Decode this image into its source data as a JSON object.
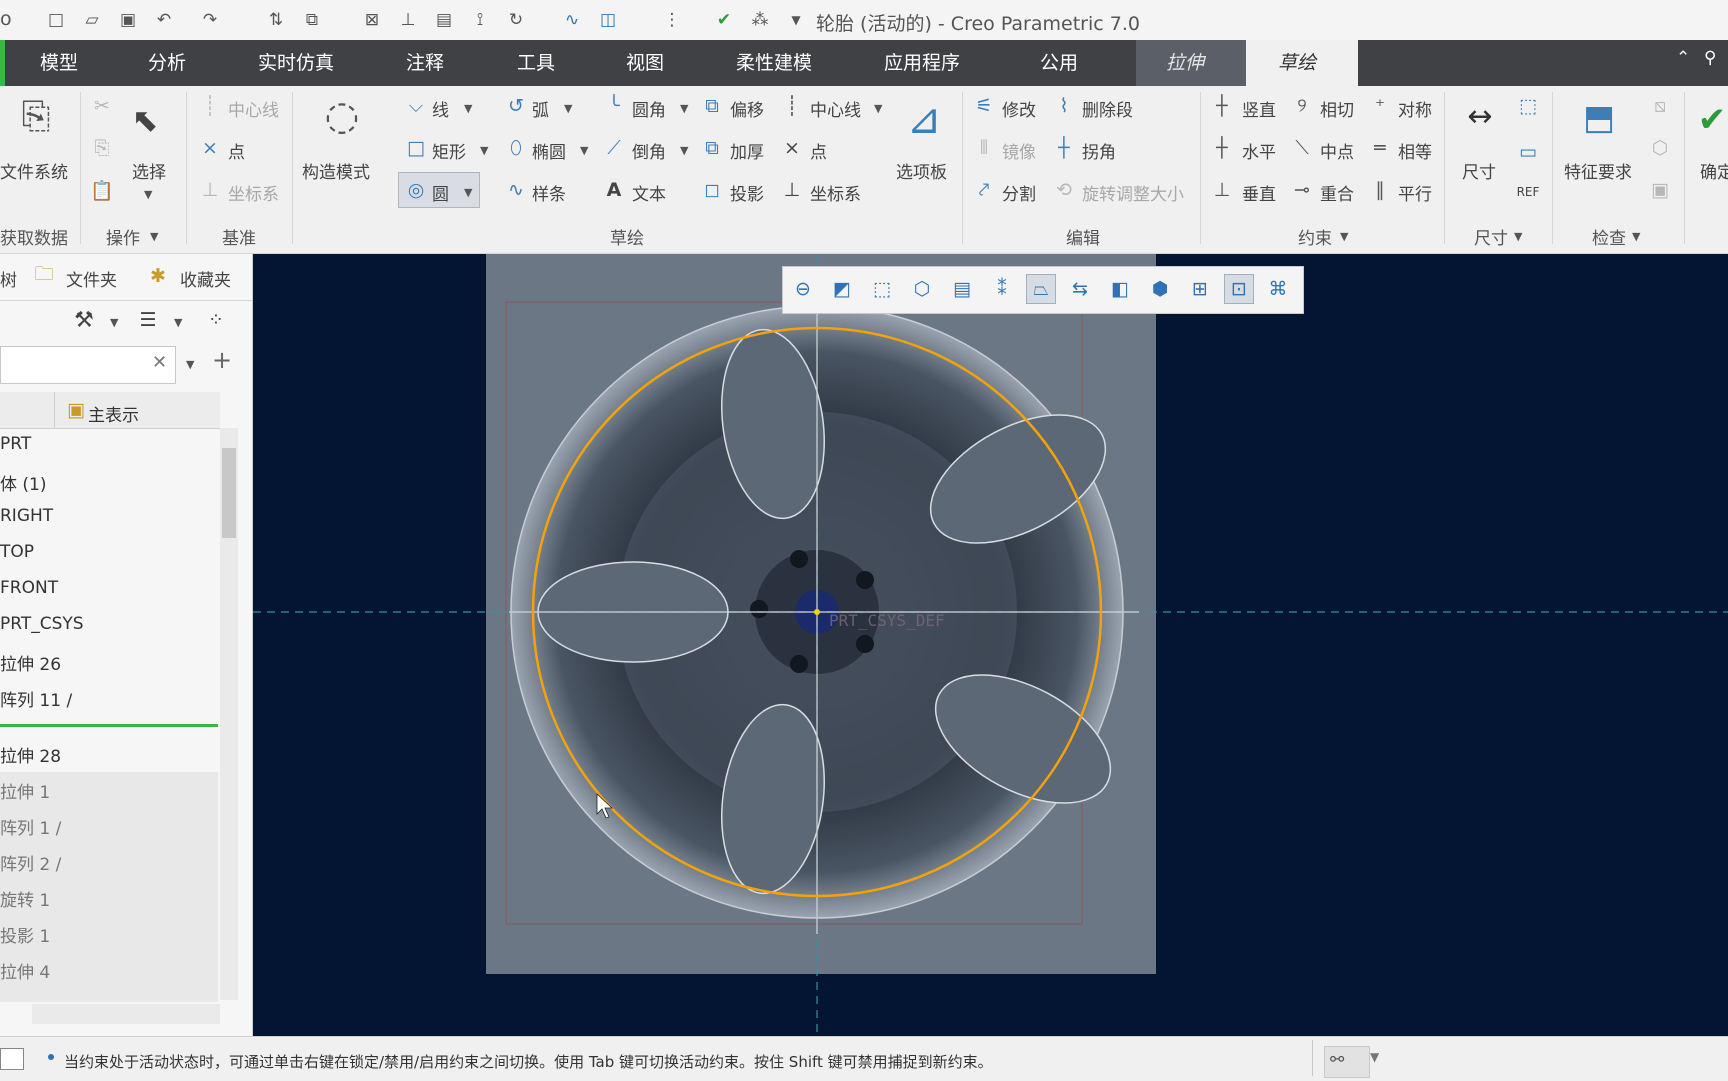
{
  "app": {
    "title": "轮胎 (活动的) - Creo Parametric 7.0",
    "title_prefix": "o"
  },
  "quick_access": {
    "icons": [
      "new-icon",
      "open-icon",
      "save-icon",
      "undo-icon",
      "redo-icon",
      "regenerate-icon",
      "windows-icon",
      "close-window-icon",
      "csys-icon",
      "datum-icon",
      "mirror-icon",
      "pattern-icon",
      "sketch-curve-icon",
      "select-box-icon",
      "more-icon",
      "confirm-check-icon",
      "display-icon"
    ]
  },
  "tabs": [
    "模型",
    "分析",
    "实时仿真",
    "注释",
    "工具",
    "视图",
    "柔性建模",
    "应用程序",
    "公用",
    "拉伸",
    "草绘"
  ],
  "active_tab": "草绘",
  "ribbon": {
    "get_data": {
      "label": "文件系统",
      "group": "获取数据"
    },
    "operations": {
      "select": "选择",
      "group": "操作"
    },
    "datum": {
      "centerline": "中心线",
      "point": "点",
      "csys": "坐标系",
      "group": "基准"
    },
    "construction": {
      "label": "构造模式"
    },
    "sketch": {
      "line": "线",
      "rect": "矩形",
      "circle": "圆",
      "arc": "弧",
      "ellipse": "椭圆",
      "spline": "样条",
      "fillet": "圆角",
      "chamfer": "倒角",
      "text": "文本",
      "offset": "偏移",
      "thicken": "加厚",
      "project": "投影",
      "centerline": "中心线",
      "point": "点",
      "csys": "坐标系",
      "palette": "选项板",
      "group": "草绘"
    },
    "edit": {
      "modify": "修改",
      "delete_segment": "删除段",
      "mirror": "镜像",
      "corner": "拐角",
      "divide": "分割",
      "rotate_resize": "旋转调整大小",
      "group": "编辑"
    },
    "constrain": {
      "vertical": "竖直",
      "tangent": "相切",
      "symmetric": "对称",
      "horizontal": "水平",
      "midpoint": "中点",
      "equal": "相等",
      "perpendicular": "垂直",
      "coincident": "重合",
      "parallel": "平行",
      "group": "约束"
    },
    "dimension": {
      "label": "尺寸",
      "group": "尺寸"
    },
    "inspect": {
      "label": "特征要求",
      "group": "检查"
    },
    "ok": {
      "label": "确定"
    }
  },
  "left_panel": {
    "tabs": [
      "树",
      "文件夹",
      "收藏夹"
    ],
    "header": "主表示",
    "tree_items": [
      "PRT",
      "体 (1)",
      "RIGHT",
      "TOP",
      "FRONT",
      "PRT_CSYS",
      "拉伸 26",
      "阵列 11 /"
    ],
    "tree_items_after": [
      "拉伸 28",
      "拉伸 1",
      "阵列 1 /",
      "阵列 2 /",
      "旋转 1",
      "投影 1",
      "拉伸 4"
    ]
  },
  "viewport": {
    "csys_label": "PRT_CSYS_DEF"
  },
  "status": {
    "message": "当约束处于活动状态时，可通过单击右键在锁定/禁用/启用约束之间切换。使用 Tab 键可切换活动约束。按住 Shift 键可禁用捕捉到新约束。"
  },
  "colors": {
    "sketch_circle": "#f2a20c",
    "viewport_bg": "#041433",
    "accent": "#39b54a"
  }
}
